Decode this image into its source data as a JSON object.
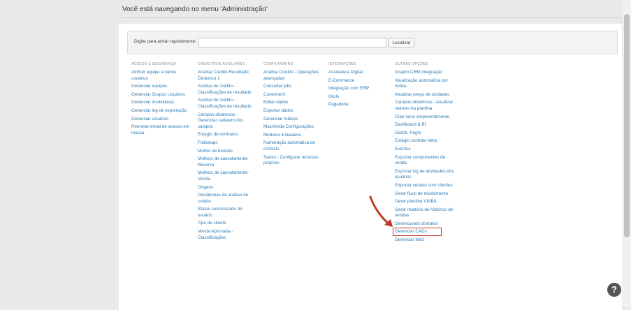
{
  "header": {
    "title": "Você está navegando no menu 'Administração'"
  },
  "search": {
    "label": "Digite para achar rapidamente:",
    "placeholder": "",
    "value": "",
    "button_label": "Localizar"
  },
  "columns": [
    {
      "title": "ACESSO & SEGURANÇA",
      "items": [
        "Atribuir equipe a vários usuários",
        "Gerenciar equipes",
        "Gerenciar Grupos Usuários",
        "Gerenciar imobiliárias",
        "Gerenciar log de exportação",
        "Gerenciar usuários",
        "Reenviar email de acesso em massa"
      ]
    },
    {
      "title": "CADASTROS AUXILIARES",
      "items": [
        "Análise Crédito Resultado Dinâmico 1",
        "Análise de crédito - Classificações de resultado",
        "Análise de crédito - Classificações de resultado",
        "Campos dinâmicos - Gerenciar cadastro dos campos",
        "Estágio de contratos",
        "Followups",
        "Motivo de distrato",
        "Motivos de cancelamento - Reserva",
        "Motivos de cancelamento - Venda",
        "Origens",
        "Pendências da análise de crédito",
        "Status customizado de usuário",
        "Tipo de cliente",
        "Venda Aprovada - Classificações"
      ]
    },
    {
      "title": "CONTA ANAPRO",
      "items": [
        "Análise Crédito - Operações avançadas",
        "Consultar jobs",
        "CustomerX",
        "Editar dados",
        "Exportar dados",
        "Gerenciar índices",
        "MaxVenda Configurações",
        "Módulos instalados",
        "Numeração automática de contrato",
        "Series - Configurar recursos próprios"
      ]
    },
    {
      "title": "INTEGRAÇÕES",
      "items": [
        "Assinatura Digital",
        "E-Commerce",
        "Integração com ERP",
        "Orulo",
        "Pagadoria"
      ]
    },
    {
      "title": "OUTRAS OPÇÕES",
      "items": [
        "Anapro CRM Integração",
        "Atualização automática por índice",
        "Atualizar preço de unidades",
        "Campos dinâmicos - Atualizar valores via planilha",
        "Criar novo empreendimento",
        "Dashboard & BI",
        "Distrib. Pagto",
        "Estágio contrato leitor",
        "Eventos",
        "Exportar componentes de venda",
        "Exportar log de atividades dos usuários",
        "Exportar vendas com clientes",
        "Gerar fluxo de recebimento",
        "Gerar planilha VIABIL",
        "Gerar relatório de histórico de vendas",
        "Gerenciando distratos",
        "Gerenciar CADs",
        "Gerenciar Mód"
      ]
    }
  ],
  "help": {
    "label": "?"
  },
  "colors": {
    "link": "#2a7ab5",
    "highlight": "#c0392b",
    "background": "#e9e9e9"
  }
}
